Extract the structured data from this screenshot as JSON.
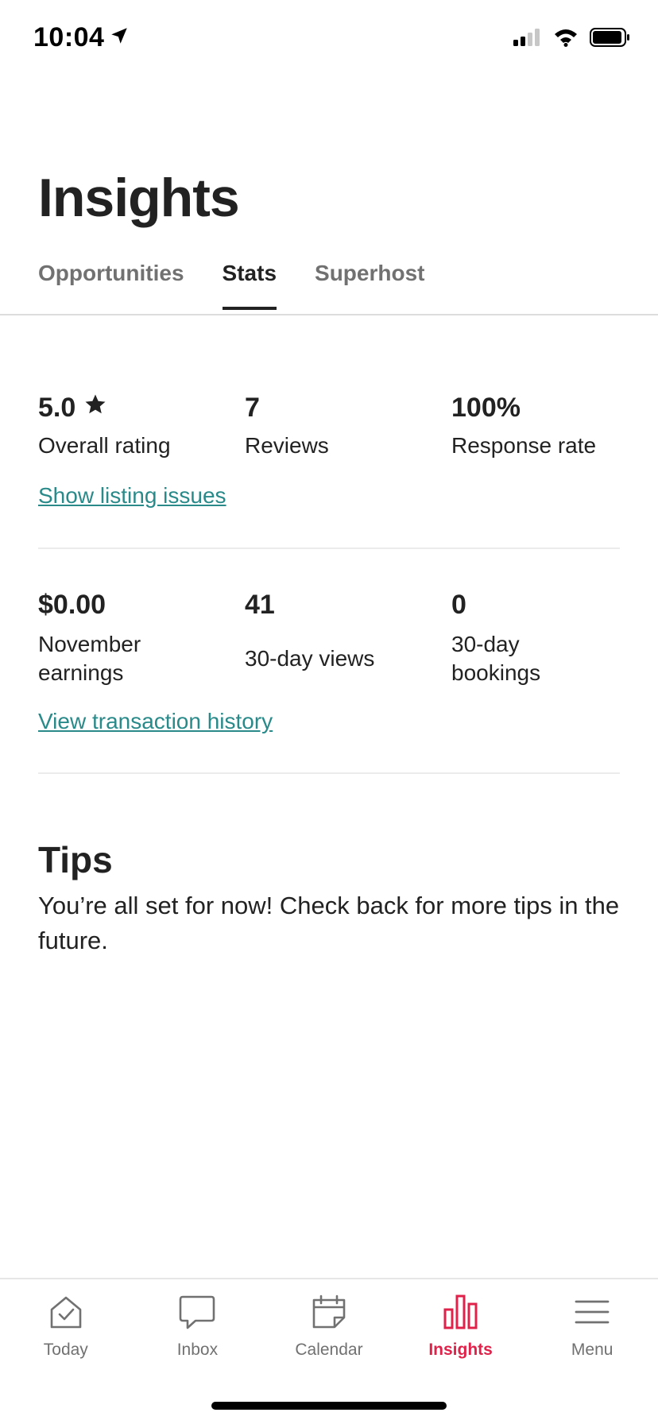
{
  "status_bar": {
    "time": "10:04",
    "icons": [
      "location-arrow-icon",
      "cellular-signal-icon",
      "wifi-icon",
      "battery-icon"
    ]
  },
  "header": {
    "title": "Insights"
  },
  "tabs": [
    {
      "label": "Opportunities",
      "active": false
    },
    {
      "label": "Stats",
      "active": true
    },
    {
      "label": "Superhost",
      "active": false
    }
  ],
  "stats_section_1": {
    "overall_rating": {
      "value": "5.0",
      "label": "Overall rating",
      "icon": "star-icon"
    },
    "reviews": {
      "value": "7",
      "label": "Reviews"
    },
    "response_rate": {
      "value": "100%",
      "label": "Response rate"
    },
    "link": "Show listing issues"
  },
  "stats_section_2": {
    "earnings": {
      "value": "$0.00",
      "label": "November earnings"
    },
    "views": {
      "value": "41",
      "label": "30-day views"
    },
    "bookings": {
      "value": "0",
      "label": "30-day bookings"
    },
    "link": "View transaction history"
  },
  "tips": {
    "title": "Tips",
    "body": "You’re all set for now! Check back for more tips in the future."
  },
  "bottom_nav": [
    {
      "label": "Today",
      "icon": "house-check-icon",
      "active": false
    },
    {
      "label": "Inbox",
      "icon": "chat-bubble-icon",
      "active": false
    },
    {
      "label": "Calendar",
      "icon": "calendar-icon",
      "active": false
    },
    {
      "label": "Insights",
      "icon": "bar-chart-icon",
      "active": true
    },
    {
      "label": "Menu",
      "icon": "hamburger-menu-icon",
      "active": false
    }
  ],
  "colors": {
    "accent": "#e0224a",
    "link": "#2a8a8a",
    "text": "#222222",
    "muted": "#717171"
  }
}
